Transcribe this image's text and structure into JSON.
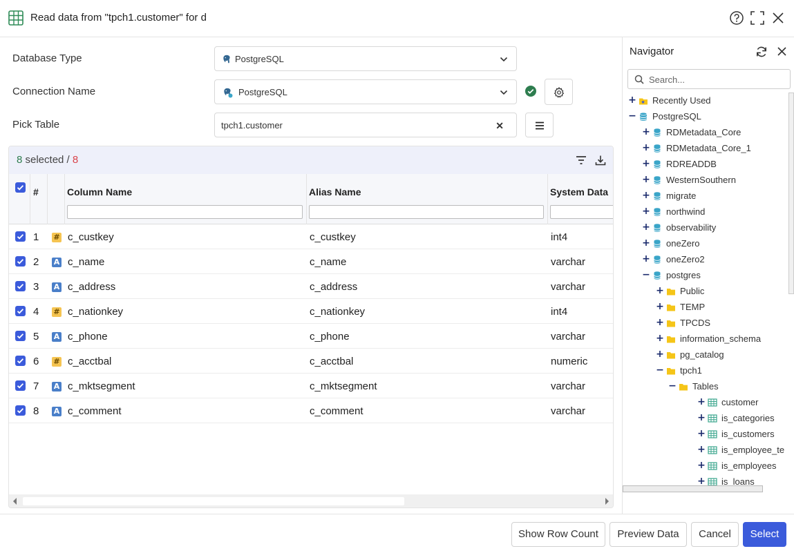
{
  "window": {
    "title": "Read data from \"tpch1.customer\" for d"
  },
  "form": {
    "database_type_label": "Database Type",
    "database_type_value": "PostgreSQL",
    "connection_name_label": "Connection Name",
    "connection_name_value": "PostgreSQL",
    "pick_table_label": "Pick Table",
    "pick_table_value": "tpch1.customer",
    "clear_glyph": "✕"
  },
  "grid": {
    "selected_count": "8",
    "selected_label": " selected / ",
    "total_count": "8",
    "headers": {
      "index": "#",
      "column_name": "Column Name",
      "alias_name": "Alias Name",
      "system_data": "System Data"
    },
    "rows": [
      {
        "n": "1",
        "type": "number",
        "column": "c_custkey",
        "alias": "c_custkey",
        "sys": "int4"
      },
      {
        "n": "2",
        "type": "string",
        "column": "c_name",
        "alias": "c_name",
        "sys": "varchar"
      },
      {
        "n": "3",
        "type": "string",
        "column": "c_address",
        "alias": "c_address",
        "sys": "varchar"
      },
      {
        "n": "4",
        "type": "number",
        "column": "c_nationkey",
        "alias": "c_nationkey",
        "sys": "int4"
      },
      {
        "n": "5",
        "type": "string",
        "column": "c_phone",
        "alias": "c_phone",
        "sys": "varchar"
      },
      {
        "n": "6",
        "type": "number",
        "column": "c_acctbal",
        "alias": "c_acctbal",
        "sys": "numeric"
      },
      {
        "n": "7",
        "type": "string",
        "column": "c_mktsegment",
        "alias": "c_mktsegment",
        "sys": "varchar"
      },
      {
        "n": "8",
        "type": "string",
        "column": "c_comment",
        "alias": "c_comment",
        "sys": "varchar"
      }
    ],
    "type_glyphs": {
      "number": "#",
      "string": "A"
    }
  },
  "navigator": {
    "title": "Navigator",
    "search_placeholder": "Search...",
    "items": [
      {
        "label": "Recently Used",
        "icon": "star-folder-icon",
        "expander": "+",
        "level": 0
      },
      {
        "label": "PostgreSQL",
        "icon": "database-server-icon",
        "expander": "−",
        "level": 0
      },
      {
        "label": "RDMetadata_Core",
        "icon": "database-icon",
        "expander": "+",
        "level": 1
      },
      {
        "label": "RDMetadata_Core_1",
        "icon": "database-icon",
        "expander": "+",
        "level": 1
      },
      {
        "label": "RDREADDB",
        "icon": "database-icon",
        "expander": "+",
        "level": 1
      },
      {
        "label": "WesternSouthern",
        "icon": "database-icon",
        "expander": "+",
        "level": 1
      },
      {
        "label": "migrate",
        "icon": "database-icon",
        "expander": "+",
        "level": 1
      },
      {
        "label": "northwind",
        "icon": "database-icon",
        "expander": "+",
        "level": 1
      },
      {
        "label": "observability",
        "icon": "database-icon",
        "expander": "+",
        "level": 1
      },
      {
        "label": "oneZero",
        "icon": "database-icon",
        "expander": "+",
        "level": 1
      },
      {
        "label": "oneZero2",
        "icon": "database-icon",
        "expander": "+",
        "level": 1
      },
      {
        "label": "postgres",
        "icon": "database-icon",
        "expander": "−",
        "level": 1
      },
      {
        "label": "Public",
        "icon": "folder-icon",
        "expander": "+",
        "level": 2
      },
      {
        "label": "TEMP",
        "icon": "folder-icon",
        "expander": "+",
        "level": 2
      },
      {
        "label": "TPCDS",
        "icon": "folder-icon",
        "expander": "+",
        "level": 2
      },
      {
        "label": "information_schema",
        "icon": "folder-icon",
        "expander": "+",
        "level": 2
      },
      {
        "label": "pg_catalog",
        "icon": "folder-icon",
        "expander": "+",
        "level": 2
      },
      {
        "label": "tpch1",
        "icon": "folder-icon",
        "expander": "−",
        "level": 2
      },
      {
        "label": "Tables",
        "icon": "folder-icon",
        "expander": "−",
        "level": 3
      },
      {
        "label": "customer",
        "icon": "table-icon",
        "expander": "+",
        "level": 4
      },
      {
        "label": "is_categories",
        "icon": "table-icon",
        "expander": "+",
        "level": 4
      },
      {
        "label": "is_customers",
        "icon": "table-icon",
        "expander": "+",
        "level": 4
      },
      {
        "label": "is_employee_te",
        "icon": "table-icon",
        "expander": "+",
        "level": 4
      },
      {
        "label": "is_employees",
        "icon": "table-icon",
        "expander": "+",
        "level": 4
      },
      {
        "label": "is_loans",
        "icon": "table-icon",
        "expander": "+",
        "level": 4
      }
    ]
  },
  "footer": {
    "show_row_count": "Show Row Count",
    "preview_data": "Preview Data",
    "cancel": "Cancel",
    "select": "Select"
  },
  "colors": {
    "accent": "#3b5bdb",
    "success": "#2e7d4f",
    "danger": "#d9434a",
    "db_teal": "#3aa5c8",
    "folder_yellow": "#f5c518"
  }
}
